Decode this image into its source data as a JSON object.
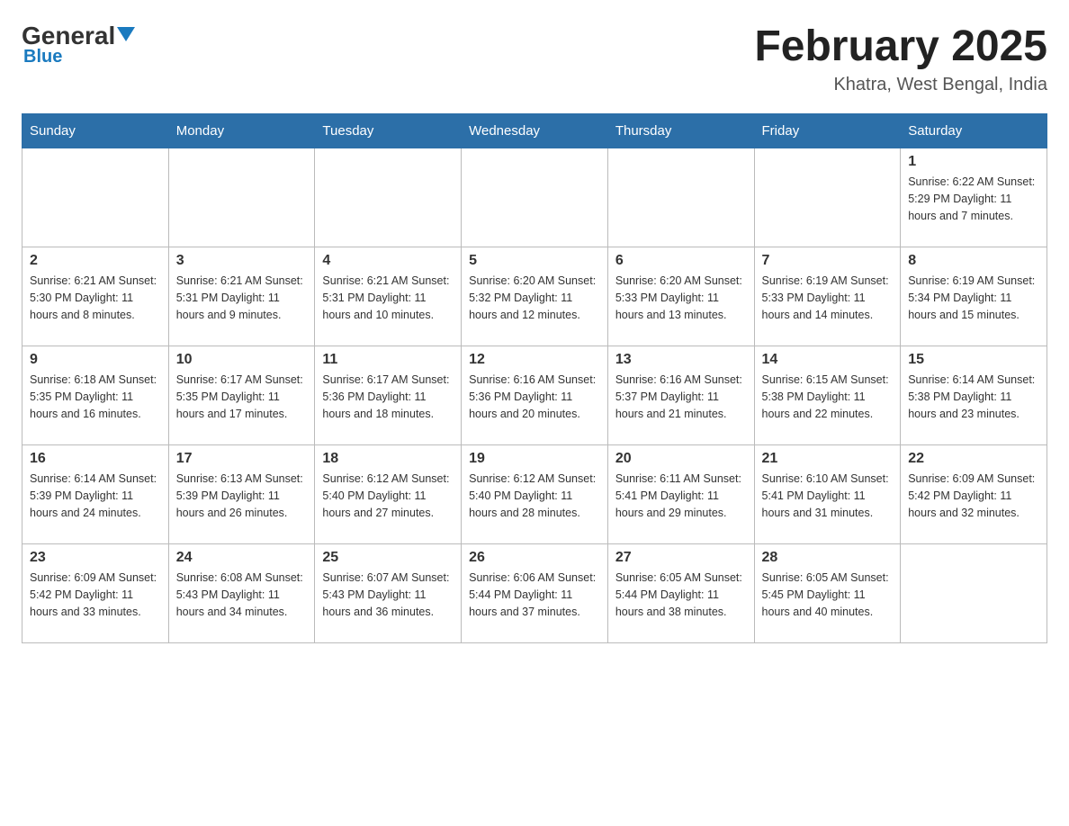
{
  "header": {
    "logo_general": "General",
    "logo_blue": "Blue",
    "title": "February 2025",
    "subtitle": "Khatra, West Bengal, India"
  },
  "days_of_week": [
    "Sunday",
    "Monday",
    "Tuesday",
    "Wednesday",
    "Thursday",
    "Friday",
    "Saturday"
  ],
  "weeks": [
    [
      {
        "day": "",
        "info": ""
      },
      {
        "day": "",
        "info": ""
      },
      {
        "day": "",
        "info": ""
      },
      {
        "day": "",
        "info": ""
      },
      {
        "day": "",
        "info": ""
      },
      {
        "day": "",
        "info": ""
      },
      {
        "day": "1",
        "info": "Sunrise: 6:22 AM\nSunset: 5:29 PM\nDaylight: 11 hours and 7 minutes."
      }
    ],
    [
      {
        "day": "2",
        "info": "Sunrise: 6:21 AM\nSunset: 5:30 PM\nDaylight: 11 hours and 8 minutes."
      },
      {
        "day": "3",
        "info": "Sunrise: 6:21 AM\nSunset: 5:31 PM\nDaylight: 11 hours and 9 minutes."
      },
      {
        "day": "4",
        "info": "Sunrise: 6:21 AM\nSunset: 5:31 PM\nDaylight: 11 hours and 10 minutes."
      },
      {
        "day": "5",
        "info": "Sunrise: 6:20 AM\nSunset: 5:32 PM\nDaylight: 11 hours and 12 minutes."
      },
      {
        "day": "6",
        "info": "Sunrise: 6:20 AM\nSunset: 5:33 PM\nDaylight: 11 hours and 13 minutes."
      },
      {
        "day": "7",
        "info": "Sunrise: 6:19 AM\nSunset: 5:33 PM\nDaylight: 11 hours and 14 minutes."
      },
      {
        "day": "8",
        "info": "Sunrise: 6:19 AM\nSunset: 5:34 PM\nDaylight: 11 hours and 15 minutes."
      }
    ],
    [
      {
        "day": "9",
        "info": "Sunrise: 6:18 AM\nSunset: 5:35 PM\nDaylight: 11 hours and 16 minutes."
      },
      {
        "day": "10",
        "info": "Sunrise: 6:17 AM\nSunset: 5:35 PM\nDaylight: 11 hours and 17 minutes."
      },
      {
        "day": "11",
        "info": "Sunrise: 6:17 AM\nSunset: 5:36 PM\nDaylight: 11 hours and 18 minutes."
      },
      {
        "day": "12",
        "info": "Sunrise: 6:16 AM\nSunset: 5:36 PM\nDaylight: 11 hours and 20 minutes."
      },
      {
        "day": "13",
        "info": "Sunrise: 6:16 AM\nSunset: 5:37 PM\nDaylight: 11 hours and 21 minutes."
      },
      {
        "day": "14",
        "info": "Sunrise: 6:15 AM\nSunset: 5:38 PM\nDaylight: 11 hours and 22 minutes."
      },
      {
        "day": "15",
        "info": "Sunrise: 6:14 AM\nSunset: 5:38 PM\nDaylight: 11 hours and 23 minutes."
      }
    ],
    [
      {
        "day": "16",
        "info": "Sunrise: 6:14 AM\nSunset: 5:39 PM\nDaylight: 11 hours and 24 minutes."
      },
      {
        "day": "17",
        "info": "Sunrise: 6:13 AM\nSunset: 5:39 PM\nDaylight: 11 hours and 26 minutes."
      },
      {
        "day": "18",
        "info": "Sunrise: 6:12 AM\nSunset: 5:40 PM\nDaylight: 11 hours and 27 minutes."
      },
      {
        "day": "19",
        "info": "Sunrise: 6:12 AM\nSunset: 5:40 PM\nDaylight: 11 hours and 28 minutes."
      },
      {
        "day": "20",
        "info": "Sunrise: 6:11 AM\nSunset: 5:41 PM\nDaylight: 11 hours and 29 minutes."
      },
      {
        "day": "21",
        "info": "Sunrise: 6:10 AM\nSunset: 5:41 PM\nDaylight: 11 hours and 31 minutes."
      },
      {
        "day": "22",
        "info": "Sunrise: 6:09 AM\nSunset: 5:42 PM\nDaylight: 11 hours and 32 minutes."
      }
    ],
    [
      {
        "day": "23",
        "info": "Sunrise: 6:09 AM\nSunset: 5:42 PM\nDaylight: 11 hours and 33 minutes."
      },
      {
        "day": "24",
        "info": "Sunrise: 6:08 AM\nSunset: 5:43 PM\nDaylight: 11 hours and 34 minutes."
      },
      {
        "day": "25",
        "info": "Sunrise: 6:07 AM\nSunset: 5:43 PM\nDaylight: 11 hours and 36 minutes."
      },
      {
        "day": "26",
        "info": "Sunrise: 6:06 AM\nSunset: 5:44 PM\nDaylight: 11 hours and 37 minutes."
      },
      {
        "day": "27",
        "info": "Sunrise: 6:05 AM\nSunset: 5:44 PM\nDaylight: 11 hours and 38 minutes."
      },
      {
        "day": "28",
        "info": "Sunrise: 6:05 AM\nSunset: 5:45 PM\nDaylight: 11 hours and 40 minutes."
      },
      {
        "day": "",
        "info": ""
      }
    ]
  ]
}
